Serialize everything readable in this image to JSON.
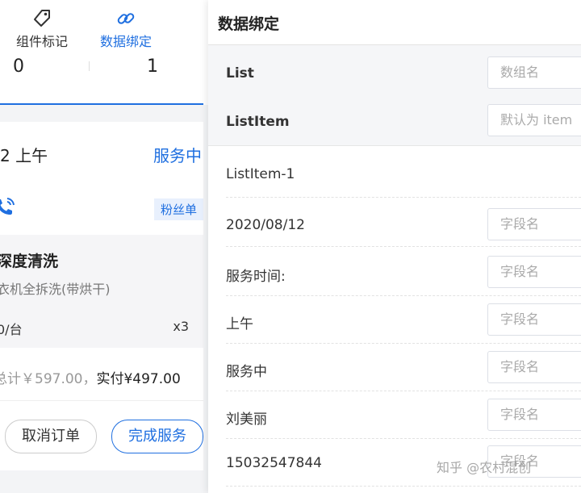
{
  "left": {
    "tabs": [
      {
        "label": "组件标记",
        "icon": "tag-icon"
      },
      {
        "label": "数据绑定",
        "icon": "link-icon"
      }
    ],
    "stats": [
      "0",
      "1"
    ],
    "order": {
      "time": "2 上午",
      "status": "服务中",
      "badge": "粉丝单",
      "service_title": "深度清洗",
      "service_sub": "衣机全拆洗(带烘干)",
      "price": "0/台",
      "qty": "x3",
      "total_prefix": "总计￥597.00，",
      "total_paid": "实付¥497.00",
      "cancel_label": "取消订单",
      "done_label": "完成服务"
    },
    "colors": {
      "accent": "#1f6fe0"
    }
  },
  "panel": {
    "title": "数据绑定",
    "list_label": "List",
    "list_placeholder": "数组名",
    "item_label": "ListItem",
    "item_placeholder": "默认为 item",
    "group_label": "ListItem-1",
    "fields": [
      {
        "label": "2020/08/12",
        "placeholder": "字段名"
      },
      {
        "label": "服务时间:",
        "placeholder": "字段名"
      },
      {
        "label": "上午",
        "placeholder": "字段名"
      },
      {
        "label": "服务中",
        "placeholder": "字段名"
      },
      {
        "label": "刘美丽",
        "placeholder": "字段名"
      },
      {
        "label": "15032547844",
        "placeholder": "字段名"
      }
    ]
  },
  "watermark": "知乎 @农村混创"
}
